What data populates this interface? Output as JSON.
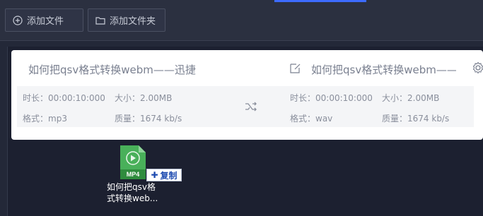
{
  "toolbar": {
    "add_file_label": "添加文件",
    "add_folder_label": "添加文件夹"
  },
  "task": {
    "source_name": "如何把qsv格式转换webm——迅捷",
    "target_name": "如何把qsv格式转换webm——",
    "source": {
      "duration_label": "时长：",
      "duration": "00:00:10:000",
      "size_label": "大小：",
      "size": "2.00MB",
      "format_label": "格式：",
      "format": "mp3",
      "quality_label": "质量：",
      "quality": "1674 kb/s"
    },
    "target": {
      "duration_label": "时长：",
      "duration": "00:00:10:000",
      "size_label": "大小：",
      "size": "2.00MB",
      "format_label": "格式：",
      "format": "wav",
      "quality_label": "质量：",
      "quality": "1674 kb/s"
    }
  },
  "drag": {
    "file_badge": "MP4",
    "copy_label": "复制",
    "file_name": "如何把qsv格式转换web..."
  },
  "icons": {
    "add": "plus-circle-icon",
    "folder": "folder-icon",
    "edit": "edit-icon",
    "settings": "gear-icon",
    "convert": "shuffle-icon",
    "file": "mp4-file-icon"
  },
  "colors": {
    "accent": "#3d6bff",
    "file_green": "#3aa34a",
    "copy_blue": "#1e4bb0"
  }
}
